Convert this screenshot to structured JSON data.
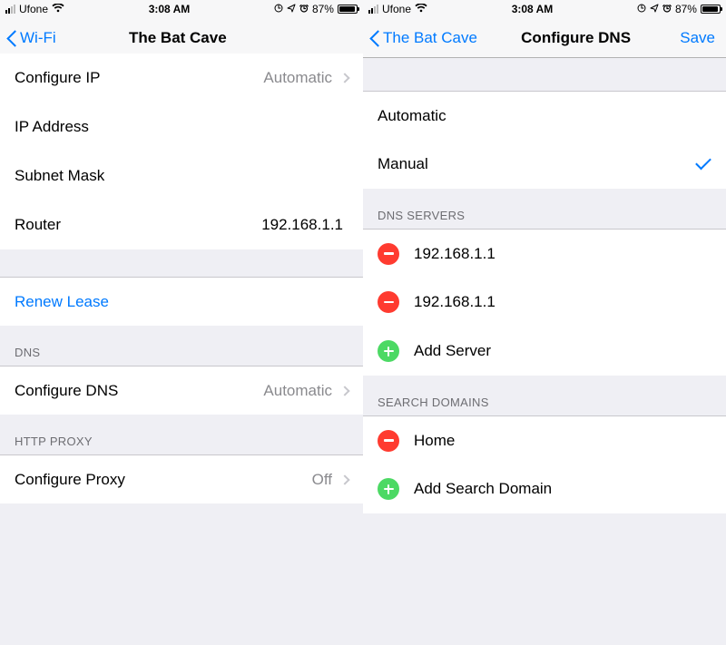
{
  "status": {
    "carrier": "Ufone",
    "time": "3:08 AM",
    "battery_pct": "87%",
    "battery_level": 87
  },
  "left": {
    "back_label": "Wi-Fi",
    "title": "The Bat Cave",
    "rows": {
      "configure_ip_label": "Configure IP",
      "configure_ip_value": "Automatic",
      "ip_address_label": "IP Address",
      "subnet_mask_label": "Subnet Mask",
      "router_label": "Router",
      "router_value": "192.168.1.1",
      "renew_lease": "Renew Lease",
      "dns_header": "DNS",
      "configure_dns_label": "Configure DNS",
      "configure_dns_value": "Automatic",
      "http_proxy_header": "HTTP PROXY",
      "configure_proxy_label": "Configure Proxy",
      "configure_proxy_value": "Off"
    }
  },
  "right": {
    "back_label": "The Bat Cave",
    "title": "Configure DNS",
    "save": "Save",
    "mode": {
      "automatic": "Automatic",
      "manual": "Manual",
      "selected": "Manual"
    },
    "dns_servers_header": "DNS SERVERS",
    "servers": [
      "192.168.1.1",
      "192.168.1.1"
    ],
    "add_server": "Add Server",
    "search_domains_header": "SEARCH DOMAINS",
    "domains": [
      "Home"
    ],
    "add_domain": "Add Search Domain"
  }
}
